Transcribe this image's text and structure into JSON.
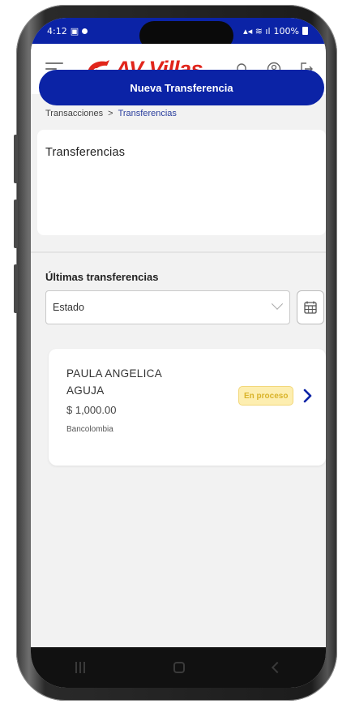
{
  "status_bar": {
    "time": "4:12",
    "battery": "100%"
  },
  "header": {
    "logo_text": "AV Villas",
    "icons": [
      "menu-icon",
      "bell-icon",
      "account-icon",
      "logout-icon"
    ]
  },
  "breadcrumb": {
    "parent": "Transacciones",
    "separator": ">",
    "current": "Transferencias"
  },
  "page": {
    "title": "Transferencias",
    "new_transfer_label": "Nueva Transferencia"
  },
  "recent": {
    "title": "Últimas transferencias",
    "filter_value": "Estado",
    "transactions": [
      {
        "name": "PAULA ANGELICA AGUJA",
        "amount": "$ 1,000.00",
        "bank": "Bancolombia",
        "status": "En proceso"
      }
    ]
  },
  "colors": {
    "primary": "#0b23a6",
    "brand_red": "#e1251b",
    "status_pending_bg": "#fdeeb0",
    "status_pending_text": "#d9b32a"
  }
}
